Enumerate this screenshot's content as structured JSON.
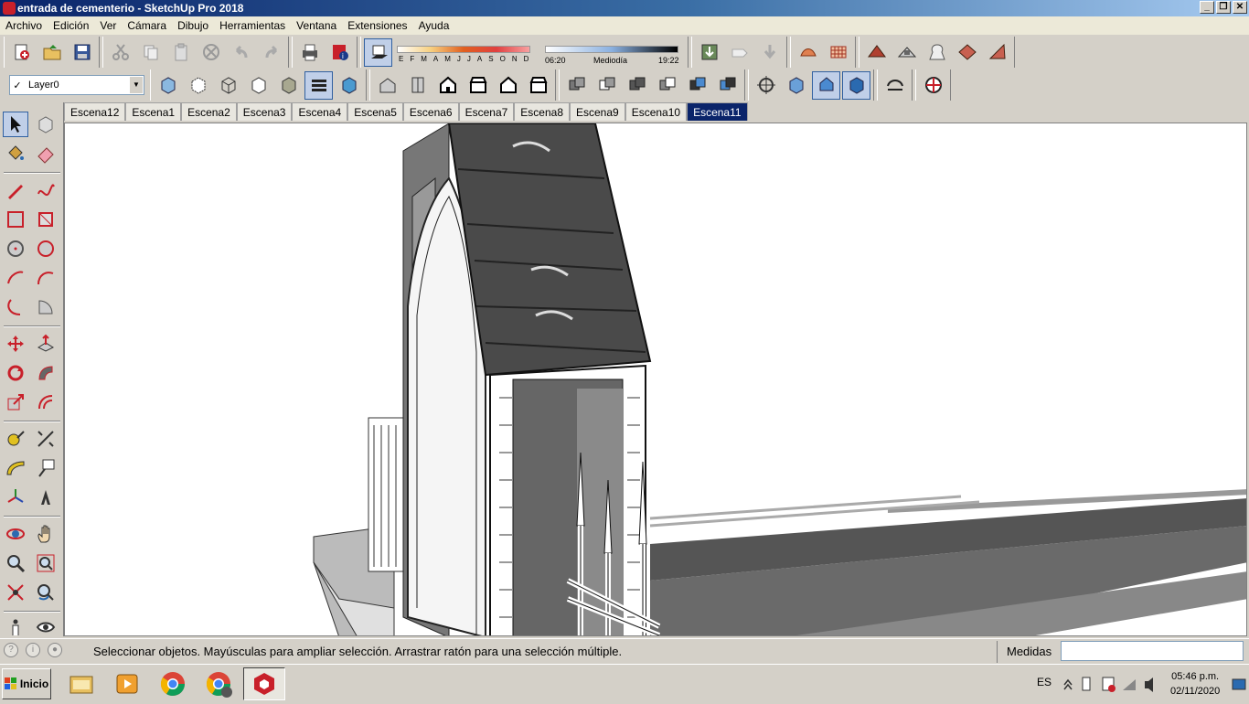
{
  "window": {
    "title": "entrada de cementerio - SketchUp Pro 2018",
    "controls": [
      "_",
      "❐",
      "✕"
    ]
  },
  "menu": [
    "Archivo",
    "Edición",
    "Ver",
    "Cámara",
    "Dibujo",
    "Herramientas",
    "Ventana",
    "Extensiones",
    "Ayuda"
  ],
  "shadows": {
    "months": [
      "E",
      "F",
      "M",
      "A",
      "M",
      "J",
      "J",
      "A",
      "S",
      "O",
      "N",
      "D"
    ],
    "time_start": "06:20",
    "time_mid": "Mediodía",
    "time_end": "19:22"
  },
  "layer": {
    "current": "Layer0",
    "check": "✓"
  },
  "scenes": {
    "tabs": [
      "Escena12",
      "Escena1",
      "Escena2",
      "Escena3",
      "Escena4",
      "Escena5",
      "Escena6",
      "Escena7",
      "Escena8",
      "Escena9",
      "Escena10",
      "Escena11"
    ],
    "active": "Escena11"
  },
  "status": {
    "message": "Seleccionar objetos. Mayúsculas para ampliar selección. Arrastrar ratón para una selección múltiple.",
    "measurements_label": "Medidas",
    "measurements_value": ""
  },
  "taskbar": {
    "start_label": "Inicio",
    "language": "ES",
    "time": "05:46 p.m.",
    "date": "02/11/2020"
  },
  "colors": {
    "accent": "#0a246a",
    "sketchup_red": "#c8202a"
  }
}
